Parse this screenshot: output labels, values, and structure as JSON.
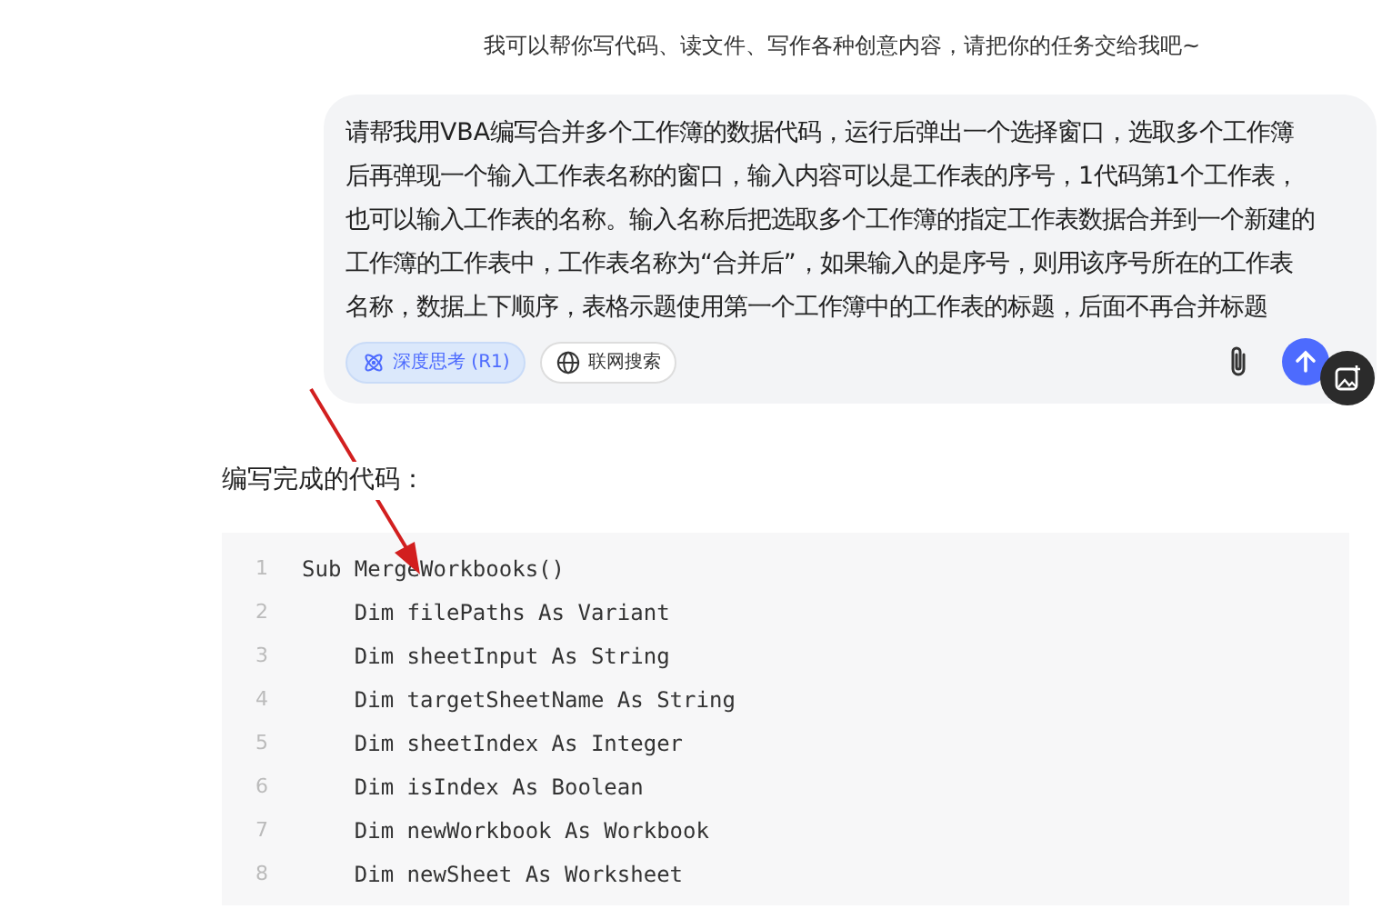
{
  "greeting": "我可以帮你写代码、读文件、写作各种创意内容，请把你的任务交给我吧~",
  "prompt": {
    "value": "请帮我用VBA编写合并多个工作簿的数据代码，运行后弹出一个选择窗口，选取多个工作簿后再弹现一个输入工作表名称的窗口，输入内容可以是工作表的序号，1代码第1个工作表，也可以输入工作表的名称。输入名称后把选取多个工作簿的指定工作表数据合并到一个新建的工作簿的工作表中，工作表名称为“合并后”，如果输入的是序号，则用该序号所在的工作表名称，数据上下顺序，表格示题使用第一个工作簿中的工作表的标题，后面不再合并标题",
    "toggles": [
      {
        "label": "深度思考 (R1)",
        "kind": "think",
        "selected": true
      },
      {
        "label": "联网搜索",
        "kind": "web",
        "selected": false
      }
    ]
  },
  "heading": "编写完成的代码：",
  "code": [
    {
      "number": "1",
      "text": "Sub MergeWorkbooks()"
    },
    {
      "number": "2",
      "text": "    Dim filePaths As Variant"
    },
    {
      "number": "3",
      "text": "    Dim sheetInput As String"
    },
    {
      "number": "4",
      "text": "    Dim targetSheetName As String"
    },
    {
      "number": "5",
      "text": "    Dim sheetIndex As Integer"
    },
    {
      "number": "6",
      "text": "    Dim isIndex As Boolean"
    },
    {
      "number": "7",
      "text": "    Dim newWorkbook As Workbook"
    },
    {
      "number": "8",
      "text": "    Dim newSheet As Worksheet"
    }
  ]
}
